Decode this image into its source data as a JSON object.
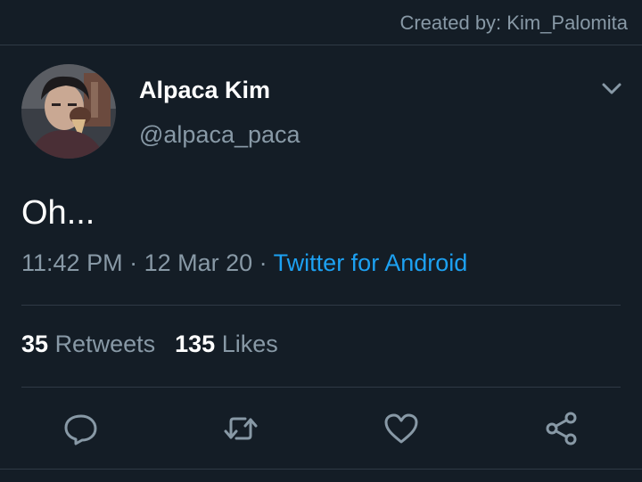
{
  "credit": "Created by: Kim_Palomita",
  "tweet": {
    "display_name": "Alpaca Kim",
    "handle": "@alpaca_paca",
    "text": "Oh...",
    "time": "11:42 PM",
    "separator": " · ",
    "date": "12 Mar 20",
    "source": "Twitter for Android"
  },
  "stats": {
    "retweets_count": "35",
    "retweets_label": "Retweets",
    "likes_count": "135",
    "likes_label": "Likes"
  },
  "icons": {
    "more": "chevron-down-icon",
    "reply": "reply-icon",
    "retweet": "retweet-icon",
    "like": "heart-icon",
    "share": "share-icon"
  },
  "colors": {
    "background": "#141d26",
    "text_primary": "#ffffff",
    "text_secondary": "#8899a6",
    "link": "#1da1f2",
    "divider": "#2f3a45"
  }
}
